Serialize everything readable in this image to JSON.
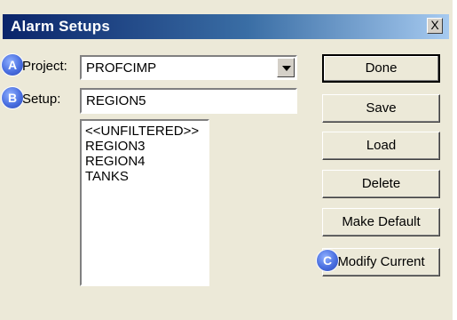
{
  "window": {
    "title": "Alarm Setups",
    "close_glyph": "X"
  },
  "badges": {
    "project": "A",
    "setup": "B",
    "modify": "C"
  },
  "project": {
    "label": "Project:",
    "value": "PROFCIMP"
  },
  "setup": {
    "label": "Setup:",
    "value": "REGION5",
    "list": [
      "<<UNFILTERED>>",
      "REGION3",
      "REGION4",
      "TANKS"
    ]
  },
  "buttons": {
    "done": "Done",
    "save": "Save",
    "load": "Load",
    "delete": "Delete",
    "make_default": "Make Default",
    "modify_current": "Modify Current"
  },
  "colors": {
    "badge_blue": "#4a6fe0",
    "titlebar_start": "#0a246a",
    "dialog_face": "#ece9d8"
  }
}
